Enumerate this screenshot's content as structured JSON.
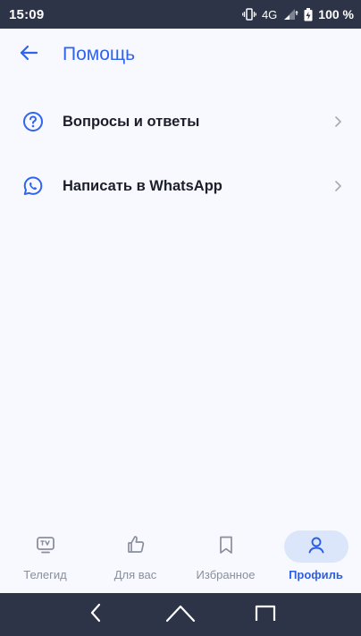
{
  "status_bar": {
    "time": "15:09",
    "network": "4G",
    "battery": "100 %"
  },
  "header": {
    "title": "Помощь",
    "back_icon": "arrow-left-icon"
  },
  "menu": {
    "items": [
      {
        "label": "Вопросы и ответы",
        "icon": "question-circle-icon"
      },
      {
        "label": "Написать в WhatsApp",
        "icon": "whatsapp-icon"
      }
    ]
  },
  "bottom_nav": {
    "tabs": [
      {
        "label": "Телегид",
        "icon": "tv-icon",
        "active": false
      },
      {
        "label": "Для вас",
        "icon": "thumbs-up-icon",
        "active": false
      },
      {
        "label": "Избранное",
        "icon": "bookmark-icon",
        "active": false
      },
      {
        "label": "Профиль",
        "icon": "profile-icon",
        "active": true
      }
    ]
  },
  "colors": {
    "accent": "#3064ef",
    "active_pill": "#dbe6fb",
    "status_bar": "#2d3447",
    "background": "#f7f9fe"
  }
}
